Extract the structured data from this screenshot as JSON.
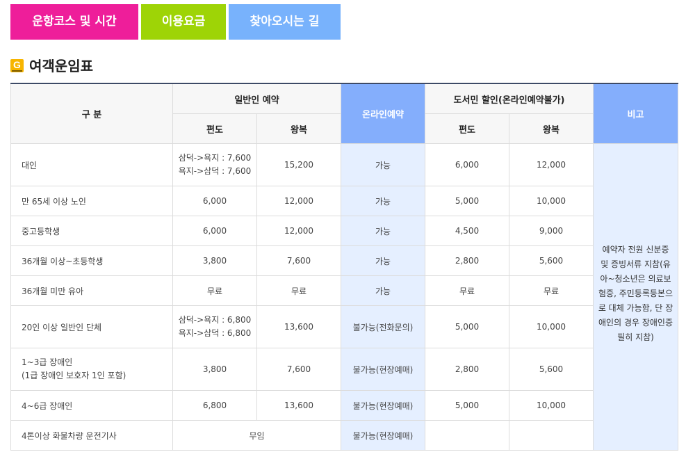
{
  "tabs": [
    {
      "label": "운항코스 및 시간",
      "color": "#ee1e9a"
    },
    {
      "label": "이용요금",
      "color": "#9ed406"
    },
    {
      "label": "찾아오시는 길",
      "color": "#78b2fc"
    }
  ],
  "section": {
    "icon_letter": "G",
    "title": "여객운임표"
  },
  "table": {
    "header": {
      "category": "구 분",
      "general": "일반인 예약",
      "online": "온라인예약",
      "islander": "도서민 할인(온라인예약불가)",
      "note": "비고",
      "one_way": "편도",
      "round_trip": "왕복"
    },
    "rows": [
      {
        "label": "대인",
        "g_one_way_1": "삼덕->욕지 : 7,600",
        "g_one_way_2": "욕지->삼덕 : 7,600",
        "g_round": "15,200",
        "online": "가능",
        "i_one_way": "6,000",
        "i_round": "12,000"
      },
      {
        "label": "만 65세 이상 노인",
        "g_one_way_1": "6,000",
        "g_one_way_2": "",
        "g_round": "12,000",
        "online": "가능",
        "i_one_way": "5,000",
        "i_round": "10,000"
      },
      {
        "label": "중고등학생",
        "g_one_way_1": "6,000",
        "g_one_way_2": "",
        "g_round": "12,000",
        "online": "가능",
        "i_one_way": "4,500",
        "i_round": "9,000"
      },
      {
        "label": "36개월 이상~초등학생",
        "g_one_way_1": "3,800",
        "g_one_way_2": "",
        "g_round": "7,600",
        "online": "가능",
        "i_one_way": "2,800",
        "i_round": "5,600"
      },
      {
        "label": "36개월 미만 유아",
        "g_one_way_1": "무료",
        "g_one_way_2": "",
        "g_round": "무료",
        "online": "가능",
        "i_one_way": "무료",
        "i_round": "무료"
      },
      {
        "label": "20인 이상 일반인 단체",
        "g_one_way_1": "삼덕->욕지 : 6,800",
        "g_one_way_2": "욕지->삼덕 : 6,800",
        "g_round": "13,600",
        "online": "불가능(전화문의)",
        "i_one_way": "5,000",
        "i_round": "10,000"
      },
      {
        "label": "1~3급 장애인",
        "label2": "(1급 장애인 보호자 1인 포함)",
        "g_one_way_1": "3,800",
        "g_one_way_2": "",
        "g_round": "7,600",
        "online": "불가능(현장예매)",
        "i_one_way": "2,800",
        "i_round": "5,600"
      },
      {
        "label": "4~6급 장애인",
        "g_one_way_1": "6,800",
        "g_one_way_2": "",
        "g_round": "13,600",
        "online": "불가능(현장예매)",
        "i_one_way": "5,000",
        "i_round": "10,000"
      }
    ],
    "truck_row": {
      "label": "4톤이상 화물차량 운전기사",
      "general_merged": "무임",
      "online": "불가능(현장예매)"
    },
    "note_text": "예약자 전원 신분증 및 증빙서류 지참(유아~청소년은 의료보험증, 주민등록등본으로 대체 가능함, 단 장애인의 경우 장애인증 필히 지참)"
  }
}
